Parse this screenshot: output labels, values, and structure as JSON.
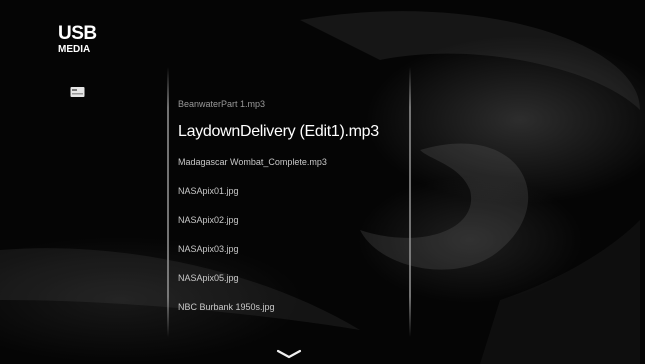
{
  "header": {
    "title_line1": "USB",
    "title_line2": "MEDIA"
  },
  "sidebar": {
    "device_icon": "usb-drive-icon"
  },
  "file_list": {
    "items": [
      "BeanwaterPart 1.mp3",
      "LaydownDelivery (Edit1).mp3",
      "Madagascar Wombat_Complete.mp3",
      "NASApix01.jpg",
      "NASApix02.jpg",
      "NASApix03.jpg",
      "NASApix05.jpg",
      "NBC Burbank 1950s.jpg"
    ],
    "selected_index": 1
  },
  "navigation": {
    "scroll_icon": "chevron-down-icon"
  }
}
